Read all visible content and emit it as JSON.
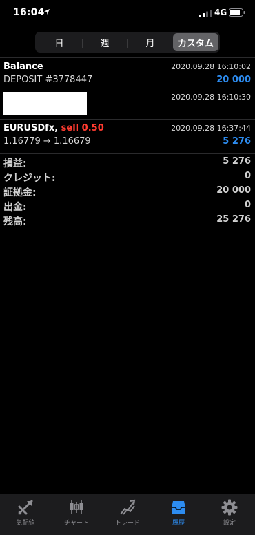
{
  "status_bar": {
    "time": "16:04",
    "network": "4G"
  },
  "segments": [
    {
      "label": "日",
      "active": false
    },
    {
      "label": "週",
      "active": false
    },
    {
      "label": "月",
      "active": false
    },
    {
      "label": "カスタム",
      "active": true
    }
  ],
  "deposit": {
    "title": "Balance",
    "comment": "DEPOSIT #3778447",
    "time": "2020.09.28 16:10:02",
    "amount": "20 000"
  },
  "redacted_row": {
    "time": "2020.09.28 16:10:30"
  },
  "order": {
    "symbol": "EURUSDfx,",
    "side": "sell 0.50",
    "prices": "1.16779 → 1.16679",
    "time": "2020.09.28 16:37:44",
    "profit": "5 276"
  },
  "summary": [
    {
      "label": "損益:",
      "value": "5 276"
    },
    {
      "label": "クレジット:",
      "value": "0"
    },
    {
      "label": "証拠金:",
      "value": "20 000"
    },
    {
      "label": "出金:",
      "value": "0"
    },
    {
      "label": "残高:",
      "value": "25 276"
    }
  ],
  "tabs": [
    {
      "label": "気配値",
      "icon": "quotes-icon",
      "active": false
    },
    {
      "label": "チャート",
      "icon": "chart-icon",
      "active": false
    },
    {
      "label": "トレード",
      "icon": "trade-icon",
      "active": false
    },
    {
      "label": "履歴",
      "icon": "history-icon",
      "active": true
    },
    {
      "label": "設定",
      "icon": "settings-icon",
      "active": false
    }
  ],
  "colors": {
    "accent": "#2d8cf0",
    "sell": "#ff3b30",
    "background": "#000000"
  }
}
